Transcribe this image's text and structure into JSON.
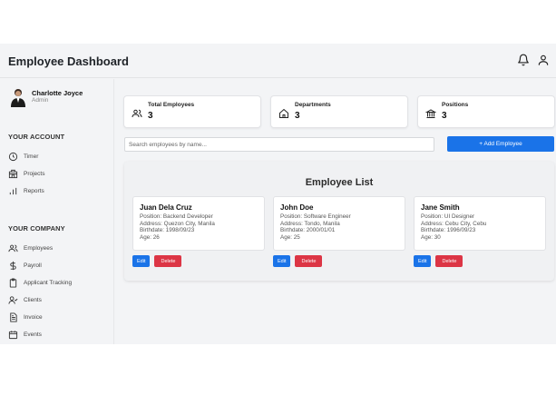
{
  "header": {
    "title": "Employee Dashboard",
    "notification_icon": "bell-icon",
    "user_icon": "user-icon"
  },
  "user": {
    "name": "Charlotte Joyce",
    "role": "Admin"
  },
  "sidebar": {
    "account_title": "YOUR ACCOUNT",
    "account_items": [
      {
        "label": "Timer",
        "icon": "clock-icon"
      },
      {
        "label": "Projects",
        "icon": "building-icon"
      },
      {
        "label": "Reports",
        "icon": "bar-chart-icon"
      }
    ],
    "company_title": "YOUR COMPANY",
    "company_items": [
      {
        "label": "Employees",
        "icon": "users-icon"
      },
      {
        "label": "Payroll",
        "icon": "dollar-icon"
      },
      {
        "label": "Applicant Tracking",
        "icon": "clipboard-icon"
      },
      {
        "label": "Clients",
        "icon": "user-check-icon"
      },
      {
        "label": "Invoice",
        "icon": "file-icon"
      },
      {
        "label": "Events",
        "icon": "calendar-icon"
      }
    ]
  },
  "stats": [
    {
      "label": "Total Employees",
      "value": "3",
      "icon": "users-icon"
    },
    {
      "label": "Departments",
      "value": "3",
      "icon": "home-icon"
    },
    {
      "label": "Positions",
      "value": "3",
      "icon": "bank-icon"
    }
  ],
  "search": {
    "placeholder": "Search employees by name..."
  },
  "add_button": "+ Add Employee",
  "list": {
    "title": "Employee List",
    "edit_label": "Edit",
    "delete_label": "Delete",
    "employees": [
      {
        "name": "Juan Dela Cruz",
        "position": "Position: Backend Developer",
        "address": "Address: Quezon City, Manila",
        "birthdate": "Birthdate: 1998/09/23",
        "age": "Age: 26"
      },
      {
        "name": "John Doe",
        "position": "Position: Software Engineer",
        "address": "Address: Tondo, Manila",
        "birthdate": "Birthdate: 2000/01/01",
        "age": "Age: 25"
      },
      {
        "name": "Jane Smith",
        "position": "Position: UI Designer",
        "address": "Address: Cebu City, Cebu",
        "birthdate": "Birthdate: 1996/09/23",
        "age": "Age: 30"
      }
    ]
  },
  "colors": {
    "primary": "#1a73e8",
    "danger": "#dc3545",
    "background": "#f3f4f6"
  }
}
